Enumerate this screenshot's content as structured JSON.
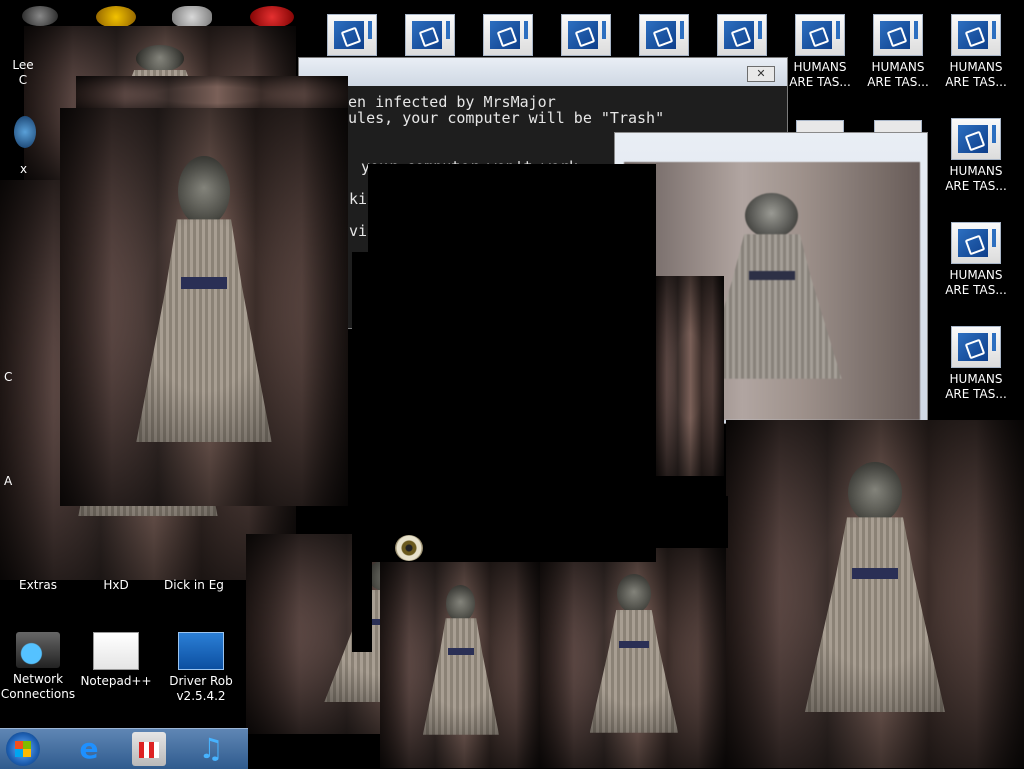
{
  "desktop": {
    "top_row_count": 6,
    "left_icons": [
      {
        "label": "Lee\nC"
      },
      {
        "label": "x"
      },
      {
        "label": "C"
      },
      {
        "label": "A"
      }
    ],
    "right_icons": [
      {
        "label": "HUMANS\nARE TAS..."
      },
      {
        "label": "HUMANS\nARE TAS..."
      },
      {
        "label": "HUMANS\nARE TAS..."
      },
      {
        "label": "HUMANS\nARE TAS..."
      },
      {
        "label": "HUMANS\nARE TAS..."
      },
      {
        "label": "HUMANS\nARE TAS..."
      }
    ],
    "bottom_labels": {
      "extras": "Extras",
      "hxd": "HxD",
      "dick": "Dick in Eg",
      "network": "Network\nConnections",
      "notepad": "Notepad++",
      "driver": "Driver Rob\nv2.5.4.2"
    }
  },
  "console": {
    "lines": [
      "een infected by MrsMajor",
      "rules, your computer will be \"Trash\""
    ],
    "fragments": [
      "your computer won't work",
      "ki",
      "vi"
    ],
    "close_glyph": "✕"
  },
  "colors": {
    "taskbar": "#2f5b8e",
    "console_bg": "#1e1e1e",
    "icon_blue": "#2d6fc0"
  },
  "taskbar": {
    "ie_glyph": "e",
    "music_glyph": "♫"
  }
}
